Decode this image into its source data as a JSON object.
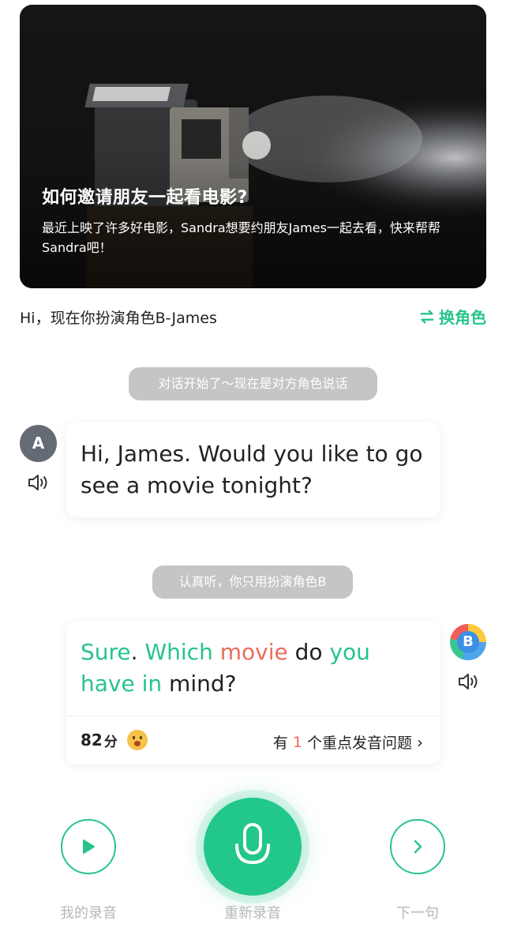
{
  "hero": {
    "title": "如何邀请朋友一起看电影?",
    "description": "最近上映了许多好电影，Sandra想要约朋友James一起去看，快来帮帮Sandra吧！"
  },
  "role": {
    "prompt": "Hi，现在你扮演角色B-James",
    "switch_label": "换角色",
    "switch_icon": "swap-arrows-icon"
  },
  "chips": {
    "start": "对话开始了～现在是对方角色说话",
    "listen": "认真听，你只用扮演角色B"
  },
  "conversation": {
    "a": {
      "avatar": "A",
      "text": "Hi, James. Would you like to go see a movie tonight?"
    },
    "b": {
      "avatar": "B",
      "words": [
        {
          "text": "Sure",
          "status": "good"
        },
        {
          "text": ". ",
          "status": "norm"
        },
        {
          "text": "Which",
          "status": "good"
        },
        {
          "text": " ",
          "status": "norm"
        },
        {
          "text": "movie",
          "status": "bad"
        },
        {
          "text": " do ",
          "status": "norm"
        },
        {
          "text": "you",
          "status": "good"
        },
        {
          "text": " ",
          "status": "norm"
        },
        {
          "text": "have",
          "status": "good"
        },
        {
          "text": " ",
          "status": "norm"
        },
        {
          "text": "in",
          "status": "good"
        },
        {
          "text": " mind?",
          "status": "norm"
        }
      ],
      "score": "82",
      "score_unit": "分",
      "issue_prefix": "有",
      "issue_count": "1",
      "issue_suffix": "个重点发音问题"
    }
  },
  "controls": {
    "play_label": "我的录音",
    "mic_label": "重新录音",
    "next_label": "下一句"
  },
  "colors": {
    "accent": "#27c48a",
    "error": "#ef6b5b",
    "chip": "#c4c5c7"
  }
}
